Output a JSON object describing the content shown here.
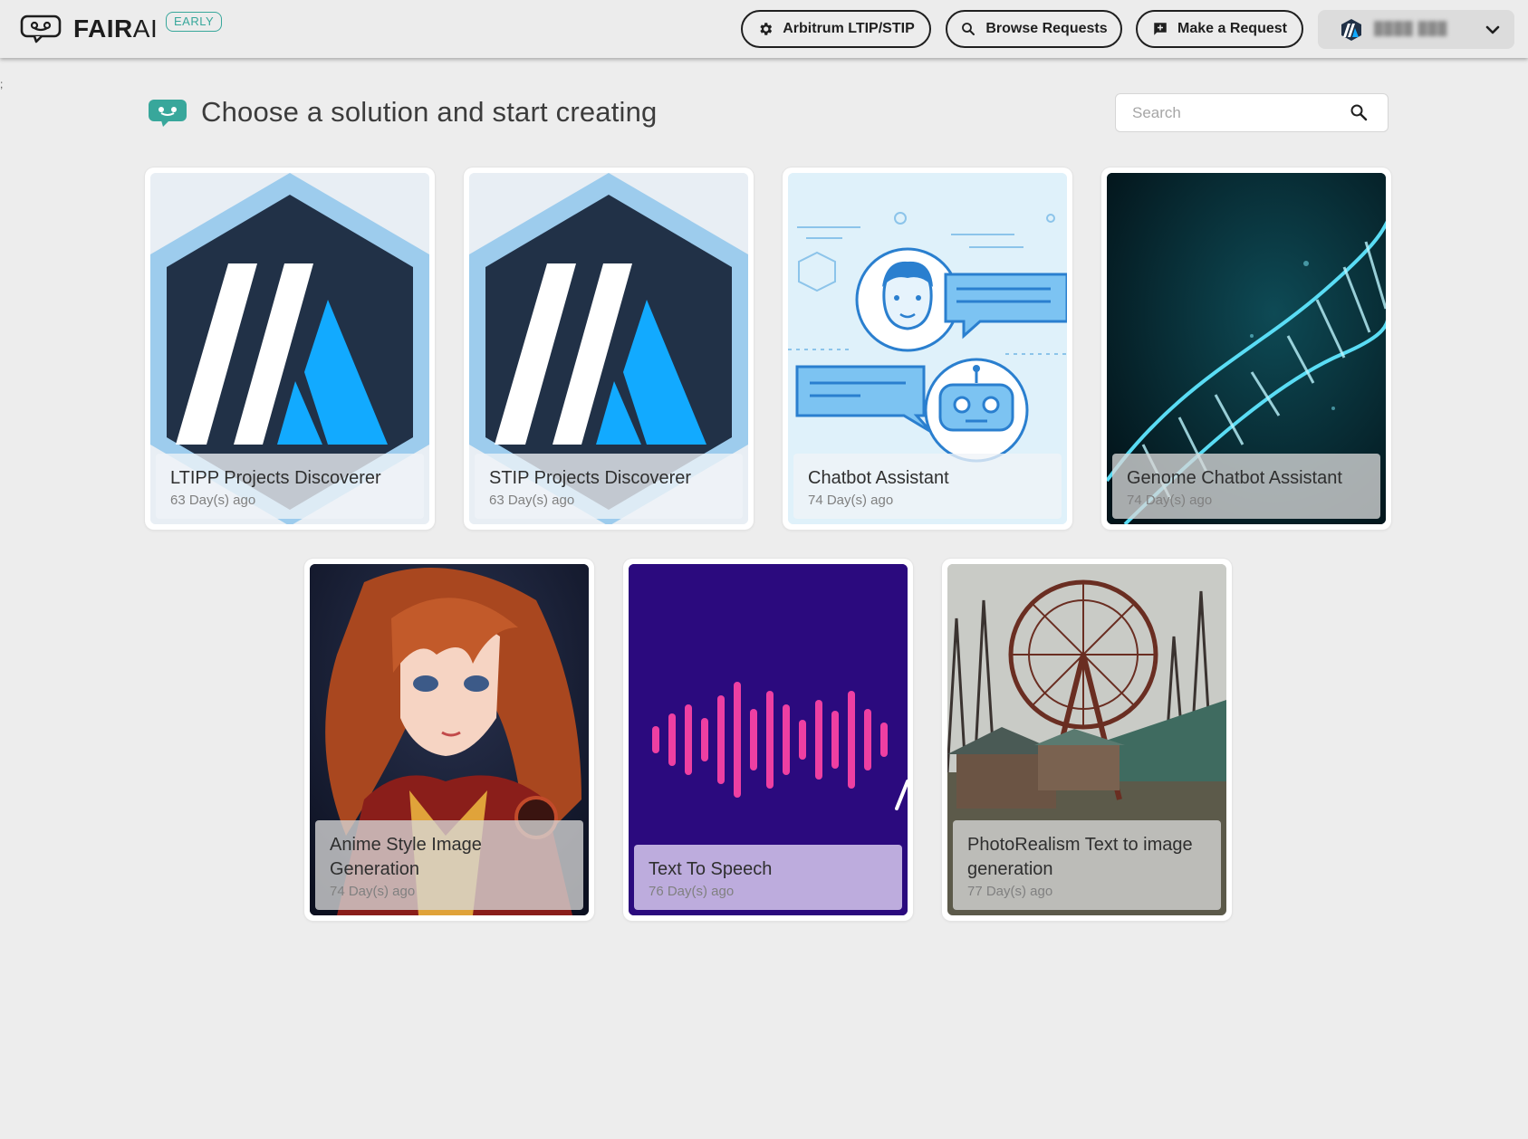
{
  "header": {
    "brand_bold": "FAIR",
    "brand_light": "AI",
    "badge": "EARLY",
    "nav": [
      {
        "label": "Arbitrum LTIP/STIP",
        "icon": "gear-icon"
      },
      {
        "label": "Browse Requests",
        "icon": "search-icon"
      },
      {
        "label": "Make a Request",
        "icon": "chat-plus-icon"
      }
    ],
    "user": {
      "name": "████ ███",
      "avatar_icon": "arbitrum-avatar-icon"
    }
  },
  "stray_text": ";",
  "page": {
    "title": "Choose a solution and start creating",
    "search_placeholder": "Search"
  },
  "cards": [
    {
      "title": "LTIPP Projects Discoverer",
      "date": "63 Day(s) ago",
      "image": "arbitrum-logo"
    },
    {
      "title": "STIP Projects Discoverer",
      "date": "63 Day(s) ago",
      "image": "arbitrum-logo"
    },
    {
      "title": "Chatbot Assistant",
      "date": "74 Day(s) ago",
      "image": "chatbot-illustration"
    },
    {
      "title": "Genome Chatbot Assistant",
      "date": "74 Day(s) ago",
      "image": "dna-helix"
    },
    {
      "title": "Anime Style Image Generation",
      "date": "74 Day(s) ago",
      "image": "anime-portrait"
    },
    {
      "title": "Text To Speech",
      "date": "76 Day(s) ago",
      "image": "sound-wave"
    },
    {
      "title": "PhotoRealism Text to image generation",
      "date": "77 Day(s) ago",
      "image": "ferris-wheel-photo"
    }
  ],
  "colors": {
    "accent": "#38a79b",
    "arbitrum_navy": "#213147",
    "arbitrum_blue": "#12aaff",
    "arbitrum_light": "#9dcced",
    "tts_purple": "#2b0a7e",
    "tts_pink": "#ee3fa2"
  }
}
